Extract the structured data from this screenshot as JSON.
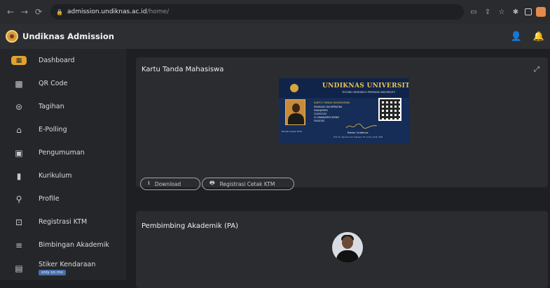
{
  "browser": {
    "url_host": "admission.undiknas.ac.id",
    "url_path": "/home/"
  },
  "header": {
    "title": "Undiknas Admission"
  },
  "sidebar": {
    "items": [
      {
        "label": "Dashboard",
        "icon": "dashboard-icon",
        "active": true
      },
      {
        "label": "QR Code",
        "icon": "qr-code-icon"
      },
      {
        "label": "Tagihan",
        "icon": "billing-icon"
      },
      {
        "label": "E-Polling",
        "icon": "polling-icon"
      },
      {
        "label": "Pengumuman",
        "icon": "announcement-icon"
      },
      {
        "label": "Kurikulum",
        "icon": "book-icon"
      },
      {
        "label": "Profile",
        "icon": "person-icon"
      },
      {
        "label": "Registrasi KTM",
        "icon": "id-card-icon"
      },
      {
        "label": "Bimbingan Akademik",
        "icon": "list-icon"
      },
      {
        "label": "Stiker Kendaraan",
        "icon": "sticker-icon",
        "badge": "only on mo"
      }
    ]
  },
  "ktm_card": {
    "title": "Kartu Tanda Mahasiswa",
    "card": {
      "university": "UNDIKNAS UNIVERSITY",
      "tagline": "TECHNO RESEARCH PREMIUM UNIVERSITY",
      "heading": "KARTU TANDA MAHASISWA",
      "line1": "DEWAGAD DAUDPRADNA",
      "line2": "MANAJEMEN",
      "line3": "210002345",
      "line4": "S1 MANAJEMEN BISNIS",
      "line5": "FAKULTAS",
      "rektor": "Rektor Undiknas",
      "rektor_sub": "Prof. Dr. Nyoman Sri Subawa, ST, S.Sos, M.M, CPM",
      "left_note": "Berlaku Sejak 2024"
    },
    "download_label": "Download",
    "cetak_label": "Registrasi Cetak KTM"
  },
  "pa_card": {
    "title": "Pembimbing Akademik (PA)"
  }
}
